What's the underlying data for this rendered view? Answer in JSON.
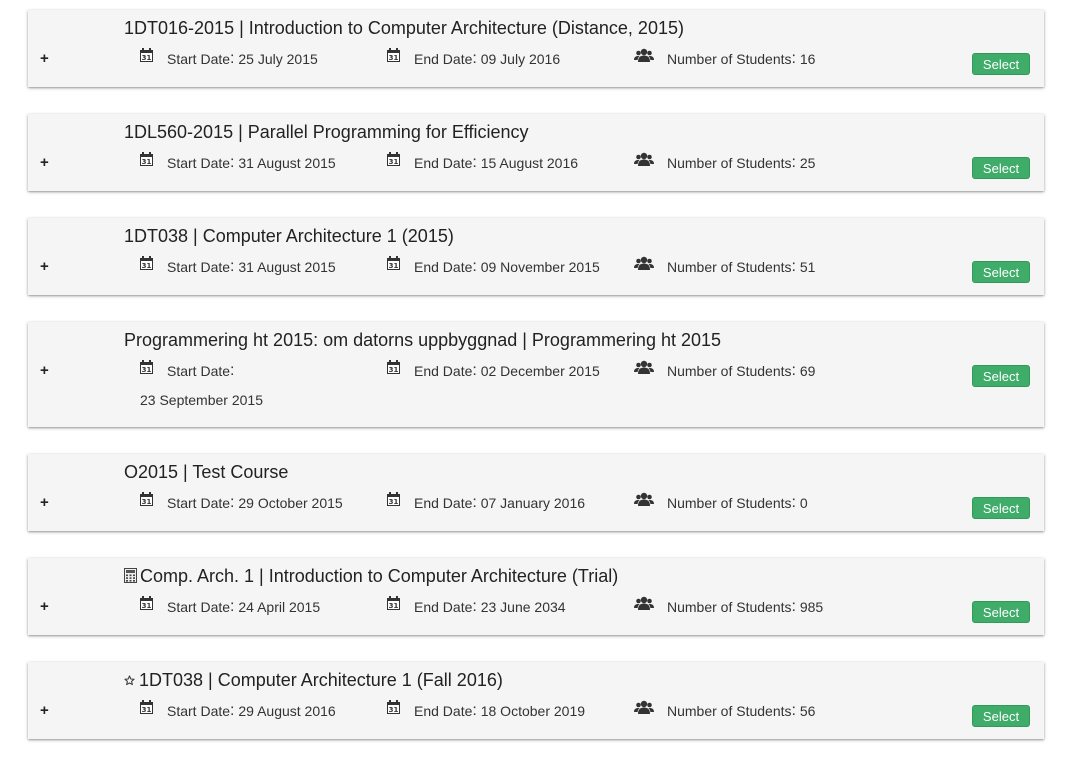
{
  "labels": {
    "start": "Start Date",
    "end": "End Date",
    "students": "Number of Students",
    "colon": ":",
    "select": "Select",
    "expand": "+"
  },
  "courses": [
    {
      "title": "1DT016-2015 | Introduction to Computer Architecture (Distance, 2015)",
      "prefix_icon": "",
      "start": "25 July 2015",
      "end": "09 July 2016",
      "students": "16"
    },
    {
      "title": "1DL560-2015 | Parallel Programming for Efficiency",
      "prefix_icon": "",
      "start": "31 August 2015",
      "end": "15 August 2016",
      "students": "25"
    },
    {
      "title": "1DT038 | Computer Architecture 1 (2015)",
      "prefix_icon": "",
      "start": "31 August 2015",
      "end": "09 November 2015",
      "students": "51"
    },
    {
      "title": "Programmering ht 2015: om datorns uppbyggnad | Programmering ht 2015",
      "prefix_icon": "",
      "start": "23 September 2015",
      "end": "02 December 2015",
      "students": "69"
    },
    {
      "title": "O2015 | Test Course",
      "prefix_icon": "",
      "start": "29 October 2015",
      "end": "07 January 2016",
      "students": "0"
    },
    {
      "title": "Comp. Arch. 1 | Introduction to Computer Architecture (Trial)",
      "prefix_icon": "▦",
      "start": "24 April 2015",
      "end": "23 June 2034",
      "students": "985"
    },
    {
      "title": "1DT038 | Computer Architecture 1 (Fall 2016)",
      "prefix_icon": "☆",
      "start": "29 August 2016",
      "end": "18 October 2019",
      "students": "56"
    }
  ],
  "icons": {
    "calendar": "calendar-icon",
    "students": "users-icon",
    "trial": "calculator-icon",
    "favorite": "star-icon"
  },
  "colors": {
    "select_button": "#3fac6a",
    "card_background": "#f5f5f5"
  }
}
